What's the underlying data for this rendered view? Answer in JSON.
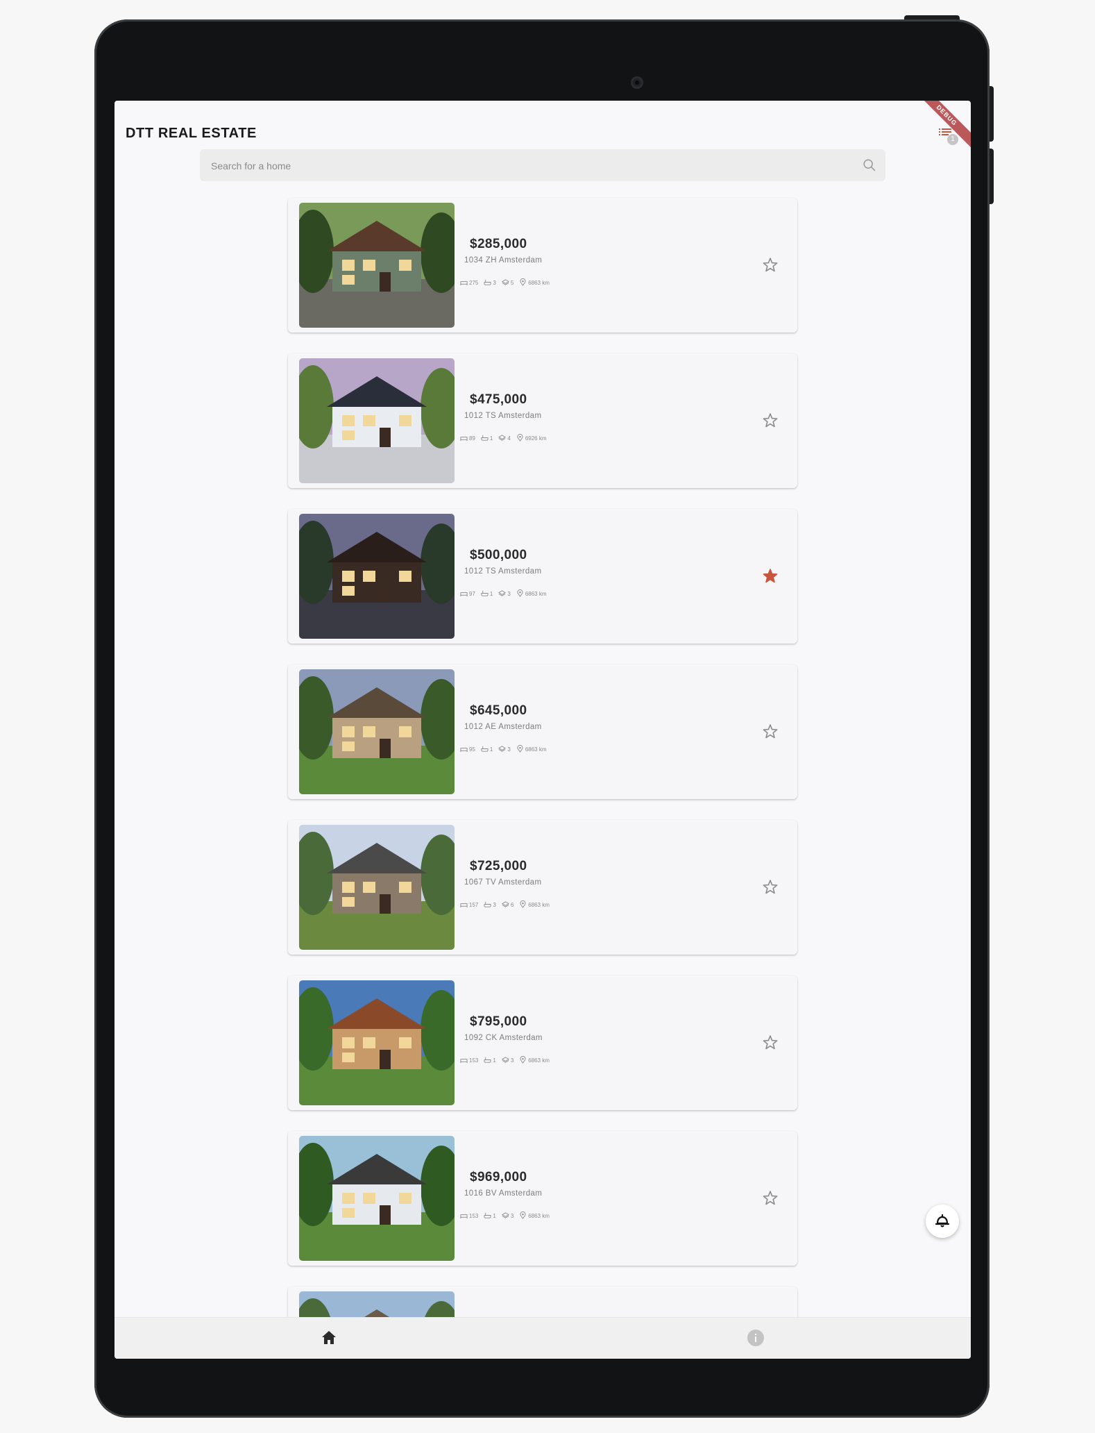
{
  "app": {
    "title": "DTT REAL ESTATE",
    "debug_banner": "DEBUG",
    "filter_count": "1"
  },
  "search": {
    "placeholder": "Search for a home",
    "value": ""
  },
  "listings": [
    {
      "price": "$285,000",
      "address": "1034 ZH Amsterdam",
      "bedrooms": "275",
      "bathrooms": "3",
      "size": "5",
      "distance": "6863 km",
      "favorite": false
    },
    {
      "price": "$475,000",
      "address": "1012 TS Amsterdam",
      "bedrooms": "89",
      "bathrooms": "1",
      "size": "4",
      "distance": "6926 km",
      "favorite": false
    },
    {
      "price": "$500,000",
      "address": "1012 TS Amsterdam",
      "bedrooms": "97",
      "bathrooms": "1",
      "size": "3",
      "distance": "6863 km",
      "favorite": true
    },
    {
      "price": "$645,000",
      "address": "1012 AE Amsterdam",
      "bedrooms": "95",
      "bathrooms": "1",
      "size": "3",
      "distance": "6863 km",
      "favorite": false
    },
    {
      "price": "$725,000",
      "address": "1067 TV Amsterdam",
      "bedrooms": "157",
      "bathrooms": "3",
      "size": "6",
      "distance": "6863 km",
      "favorite": false
    },
    {
      "price": "$795,000",
      "address": "1092 CK Amsterdam",
      "bedrooms": "153",
      "bathrooms": "1",
      "size": "3",
      "distance": "6863 km",
      "favorite": false
    },
    {
      "price": "$969,000",
      "address": "1016 BV Amsterdam",
      "bedrooms": "153",
      "bathrooms": "1",
      "size": "3",
      "distance": "6863 km",
      "favorite": false
    }
  ],
  "icons": {
    "search": "search-icon",
    "filter": "filter-list-icon",
    "favorite": "star-icon",
    "home": "home-icon",
    "info": "info-icon",
    "fab": "bell-icon"
  },
  "colors": {
    "favorite_active": "#c8553d",
    "favorite_inactive": "#8a8a8a",
    "nav_active": "#2b2b2b",
    "nav_inactive": "#bdbdbd"
  }
}
